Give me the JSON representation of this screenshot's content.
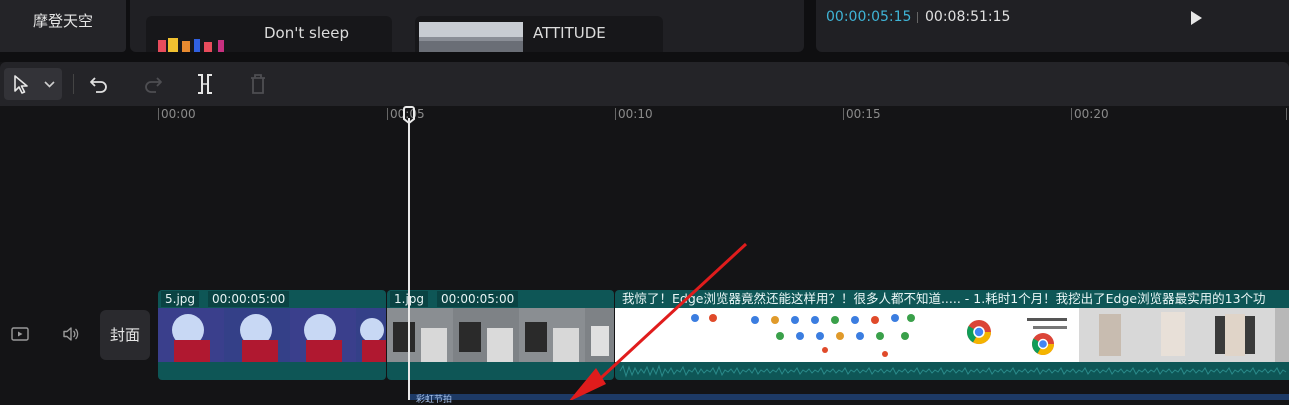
{
  "category": {
    "label": "摩登天空"
  },
  "media": {
    "cards": [
      {
        "title": "Don't sleep"
      },
      {
        "title": "ATTITUDE"
      }
    ]
  },
  "preview": {
    "time_current": "00:00:05:15",
    "time_total": "00:08:51:15"
  },
  "ruler": {
    "labels": [
      "00:00",
      "00:05",
      "00:10",
      "00:15",
      "00:20"
    ]
  },
  "track": {
    "cover_label": "封面",
    "clips": [
      {
        "name": "5.jpg",
        "duration": "00:00:05:00"
      },
      {
        "name": "1.jpg",
        "duration": "00:00:05:00"
      },
      {
        "title": "我惊了！Edge浏览器竟然还能这样用？！很多人都不知道..... - 1.耗时1个月！我挖出了Edge浏览器最实用的13个功"
      }
    ]
  },
  "audio": {
    "label": "彩虹节拍"
  },
  "colors": {
    "accent_time": "#3fb4d6",
    "clip_teal": "#0e5656",
    "audio_blue": "#1d3a66",
    "annotation_red": "#e01c1c"
  },
  "icons": [
    "pointer-icon",
    "chevron-down-icon",
    "undo-icon",
    "redo-icon",
    "split-icon",
    "delete-icon",
    "play-icon",
    "video-track-icon",
    "audio-track-icon"
  ]
}
